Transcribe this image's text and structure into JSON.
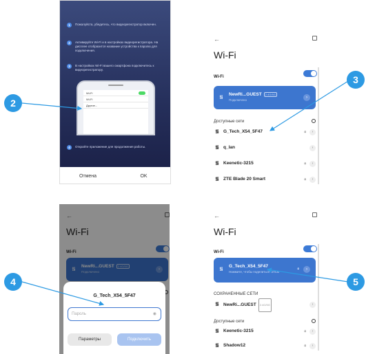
{
  "panel1": {
    "steps": [
      {
        "num": "1",
        "text": "Пожалуйста, убедитесь, что видеорегистратор включен."
      },
      {
        "num": "2",
        "text": "Активируйте Wi-Fi и в настройках видеорегистратора. На дисплее отобразится название устройства к паролю для подключения."
      },
      {
        "num": "3",
        "text": "В настройках Wi-Fi вашего смартфона подключитесь к видеорегистратору."
      },
      {
        "num": "4",
        "text": "Откройте приложение для продолжения работы."
      }
    ],
    "phone_rows": [
      "Wi-Fi",
      "Wi-Fi",
      "Другие..."
    ],
    "cancel": "Отмена",
    "ok": "OK"
  },
  "wifi": {
    "back_icon": "arrow-left-icon",
    "scan_icon": "scan-icon",
    "title": "Wi-Fi",
    "wifi_label": "Wi-Fi",
    "connected_name": "NewRi...GUEST",
    "connected_band": "2.4G/5G",
    "connected_status": "Подключено",
    "available_header": "Доступные сети",
    "saved_header": "СОХРАНЕННЫЕ СЕТИ",
    "networks_p2": [
      "G_Tech_X54_5F47",
      "q_lan",
      "Keenetic-3215",
      "ZTE Blade 20 Smart"
    ],
    "p4_connected_name": "G_Tech_X54_5F47",
    "p4_connected_status": "Нажмите, чтобы поделиться сетью",
    "p4_saved": "NewRi...GUEST",
    "networks_p4": [
      "Keenetic-3215",
      "Shadow12"
    ]
  },
  "dialog": {
    "title": "G_Tech_X54_5F47",
    "password_placeholder": "Пароль",
    "params": "Параметры",
    "connect": "Подключить"
  },
  "callouts": [
    "2",
    "3",
    "4",
    "5"
  ],
  "colors": {
    "accent": "#3d76cf",
    "callout": "#2d9ae3"
  }
}
